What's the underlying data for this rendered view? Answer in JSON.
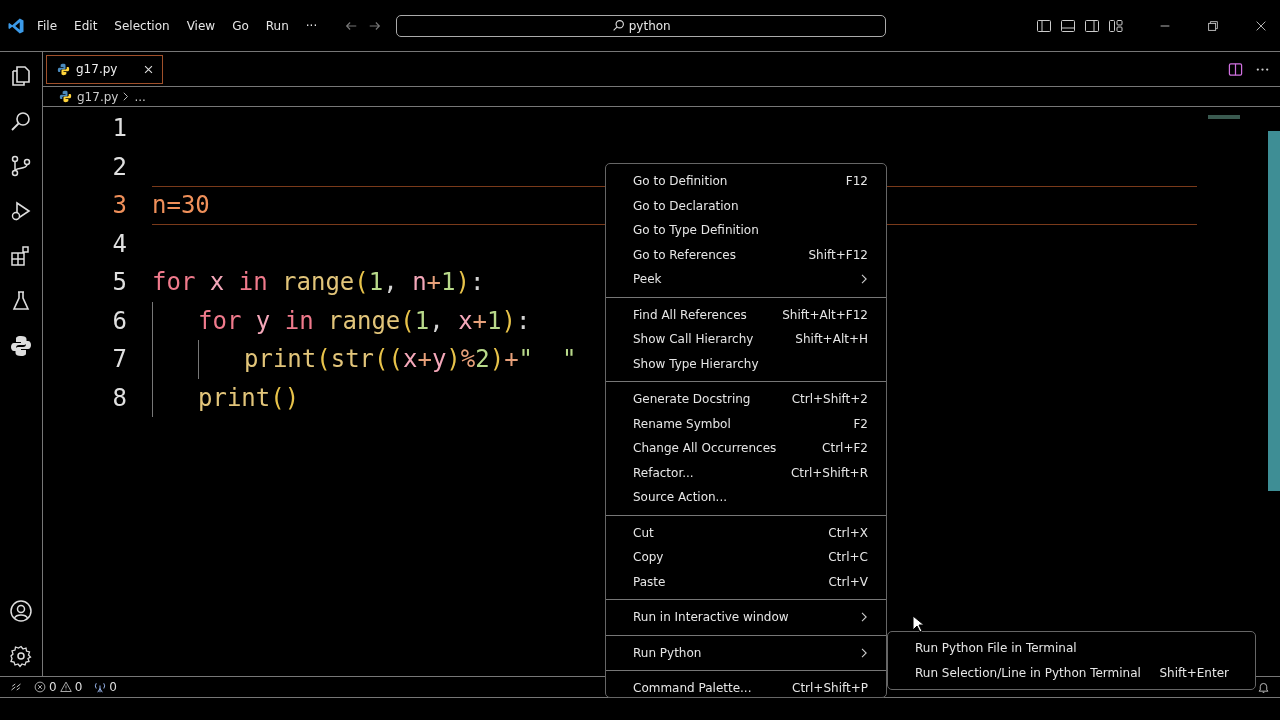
{
  "menubar": {
    "items": [
      "File",
      "Edit",
      "Selection",
      "View",
      "Go",
      "Run",
      "···"
    ]
  },
  "search": {
    "value": "python"
  },
  "tabs": [
    {
      "label": "g17.py",
      "selected": true
    }
  ],
  "breadcrumb": {
    "file": "g17.py",
    "rest": "..."
  },
  "editor": {
    "lines": [
      {
        "number": "1",
        "current": false
      },
      {
        "number": "2",
        "current": false
      },
      {
        "number": "3",
        "current": true,
        "tokens": [
          {
            "kind": "var",
            "text": "n"
          },
          {
            "kind": "op",
            "text": "="
          },
          {
            "kind": "num",
            "text": "30"
          }
        ]
      },
      {
        "number": "4",
        "current": false
      },
      {
        "number": "5",
        "current": false,
        "tokens": [
          {
            "kind": "kw",
            "text": "for "
          },
          {
            "kind": "var",
            "text": "x "
          },
          {
            "kind": "kw",
            "text": "in "
          },
          {
            "kind": "fn",
            "text": "range"
          },
          {
            "kind": "paren",
            "text": "("
          },
          {
            "kind": "num",
            "text": "1"
          },
          {
            "kind": "plain",
            "text": ", "
          },
          {
            "kind": "var",
            "text": "n"
          },
          {
            "kind": "op",
            "text": "+"
          },
          {
            "kind": "num",
            "text": "1"
          },
          {
            "kind": "paren",
            "text": ")"
          },
          {
            "kind": "plain",
            "text": ":"
          }
        ],
        "children": [
          {
            "number": "6",
            "current": false,
            "tokens": [
              {
                "kind": "kw",
                "text": "for "
              },
              {
                "kind": "var",
                "text": "y "
              },
              {
                "kind": "kw",
                "text": "in "
              },
              {
                "kind": "fn",
                "text": "range"
              },
              {
                "kind": "paren",
                "text": "("
              },
              {
                "kind": "num",
                "text": "1"
              },
              {
                "kind": "plain",
                "text": ", "
              },
              {
                "kind": "var",
                "text": "x"
              },
              {
                "kind": "op",
                "text": "+"
              },
              {
                "kind": "num",
                "text": "1"
              },
              {
                "kind": "paren",
                "text": ")"
              },
              {
                "kind": "plain",
                "text": ":"
              }
            ],
            "children": [
              {
                "number": "7",
                "current": false,
                "tokens": [
                  {
                    "kind": "fn",
                    "text": "print"
                  },
                  {
                    "kind": "paren",
                    "text": "("
                  },
                  {
                    "kind": "fn",
                    "text": "str"
                  },
                  {
                    "kind": "paren",
                    "text": "(("
                  },
                  {
                    "kind": "var",
                    "text": "x"
                  },
                  {
                    "kind": "op",
                    "text": "+"
                  },
                  {
                    "kind": "var",
                    "text": "y"
                  },
                  {
                    "kind": "paren",
                    "text": ")"
                  },
                  {
                    "kind": "op",
                    "text": "%"
                  },
                  {
                    "kind": "num",
                    "text": "2"
                  },
                  {
                    "kind": "paren",
                    "text": ")"
                  },
                  {
                    "kind": "op",
                    "text": "+"
                  },
                  {
                    "kind": "str",
                    "text": "\"  \""
                  }
                ]
              }
            ]
          },
          {
            "number": "8",
            "current": false,
            "tokens": [
              {
                "kind": "fn",
                "text": "print"
              },
              {
                "kind": "paren",
                "text": "()"
              }
            ]
          }
        ]
      }
    ]
  },
  "context_menu": {
    "groups": [
      [
        {
          "label": "Go to Definition",
          "shortcut": "F12",
          "has_submenu": false
        },
        {
          "label": "Go to Declaration",
          "has_submenu": false
        },
        {
          "label": "Go to Type Definition",
          "has_submenu": false
        },
        {
          "label": "Go to References",
          "shortcut": "Shift+F12",
          "has_submenu": false
        },
        {
          "label": "Peek",
          "has_submenu": true
        }
      ],
      [
        {
          "label": "Find All References",
          "shortcut": "Shift+Alt+F12",
          "has_submenu": false
        },
        {
          "label": "Show Call Hierarchy",
          "shortcut": "Shift+Alt+H",
          "has_submenu": false
        },
        {
          "label": "Show Type Hierarchy",
          "has_submenu": false
        }
      ],
      [
        {
          "label": "Generate Docstring",
          "shortcut": "Ctrl+Shift+2",
          "has_submenu": false
        },
        {
          "label": "Rename Symbol",
          "shortcut": "F2",
          "has_submenu": false
        },
        {
          "label": "Change All Occurrences",
          "shortcut": "Ctrl+F2",
          "has_submenu": false
        },
        {
          "label": "Refactor...",
          "shortcut": "Ctrl+Shift+R",
          "has_submenu": false
        },
        {
          "label": "Source Action...",
          "has_submenu": false
        }
      ],
      [
        {
          "label": "Cut",
          "shortcut": "Ctrl+X",
          "has_submenu": false
        },
        {
          "label": "Copy",
          "shortcut": "Ctrl+C",
          "has_submenu": false
        },
        {
          "label": "Paste",
          "shortcut": "Ctrl+V",
          "has_submenu": false
        }
      ],
      [
        {
          "label": "Run in Interactive window",
          "has_submenu": true
        }
      ],
      [
        {
          "label": "Run Python",
          "has_submenu": true
        }
      ],
      [
        {
          "label": "Command Palette...",
          "shortcut": "Ctrl+Shift+P",
          "has_submenu": false
        }
      ]
    ]
  },
  "submenu": {
    "items": [
      {
        "label": "Run Python File in Terminal"
      },
      {
        "label": "Run Selection/Line in Python Terminal",
        "shortcut": "Shift+Enter"
      }
    ]
  },
  "status_bar": {
    "errors": "0",
    "warnings": "0",
    "ports": "0"
  }
}
